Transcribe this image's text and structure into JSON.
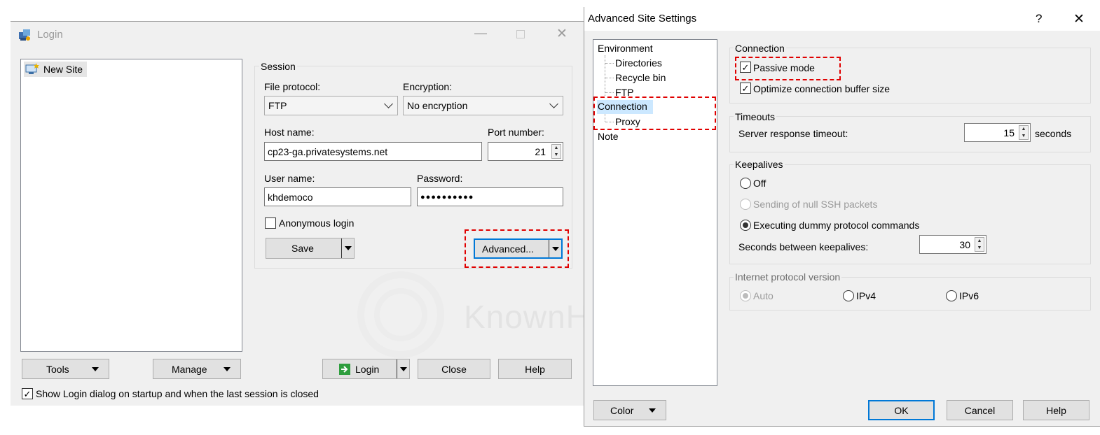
{
  "login": {
    "title": "Login",
    "site_list": [
      "New Site"
    ],
    "session_label": "Session",
    "file_protocol_label": "File protocol:",
    "file_protocol_value": "FTP",
    "encryption_label": "Encryption:",
    "encryption_value": "No encryption",
    "host_label": "Host name:",
    "host_value": "cp23-ga.privatesystems.net",
    "port_label": "Port number:",
    "port_value": "21",
    "user_label": "User name:",
    "user_value": "khdemoco",
    "password_label": "Password:",
    "password_value": "●●●●●●●●●●",
    "anonymous_label": "Anonymous login",
    "save_label": "Save",
    "advanced_label": "Advanced...",
    "tools_label": "Tools",
    "manage_label": "Manage",
    "login_label": "Login",
    "close_label": "Close",
    "help_label": "Help",
    "show_dialog_label": "Show Login dialog on startup and when the last session is closed"
  },
  "advanced": {
    "title": "Advanced Site Settings",
    "help_glyph": "?",
    "close_glyph": "✕",
    "tree": {
      "environment": "Environment",
      "directories": "Directories",
      "recycle_bin": "Recycle bin",
      "ftp": "FTP",
      "connection": "Connection",
      "proxy": "Proxy",
      "note": "Note"
    },
    "connection_group": "Connection",
    "passive_mode": "Passive mode",
    "optimize_buffer": "Optimize connection buffer size",
    "timeouts_group": "Timeouts",
    "server_timeout_label": "Server response timeout:",
    "server_timeout_value": "15",
    "seconds_label": "seconds",
    "keepalives_group": "Keepalives",
    "ka_off": "Off",
    "ka_null_ssh": "Sending of null SSH packets",
    "ka_dummy": "Executing dummy protocol commands",
    "ka_seconds_label": "Seconds between keepalives:",
    "ka_seconds_value": "30",
    "ip_group": "Internet protocol version",
    "ip_auto": "Auto",
    "ip_v4": "IPv4",
    "ip_v6": "IPv6",
    "color_label": "Color",
    "ok_label": "OK",
    "cancel_label": "Cancel",
    "help_label": "Help"
  },
  "watermark": "KnownHost"
}
